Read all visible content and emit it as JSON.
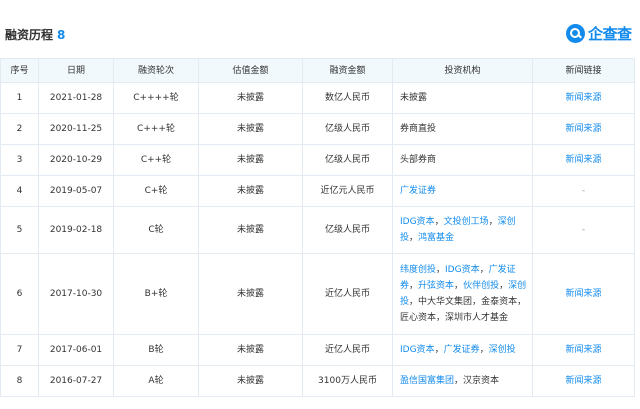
{
  "header": {
    "title": "融资历程",
    "count": "8"
  },
  "logo": {
    "text": "企查查",
    "accent": "#128bed"
  },
  "table": {
    "columns": [
      "序号",
      "日期",
      "融资轮次",
      "估值金额",
      "融资金额",
      "投资机构",
      "新闻链接"
    ],
    "rows": [
      {
        "no": "1",
        "date": "2021-01-28",
        "round": "C++++轮",
        "valuation": "未披露",
        "amount": "数亿人民币",
        "investors": [
          {
            "name": "未披露",
            "linked": false
          }
        ],
        "news": "新闻来源",
        "news_linked": true
      },
      {
        "no": "2",
        "date": "2020-11-25",
        "round": "C+++轮",
        "valuation": "未披露",
        "amount": "亿级人民币",
        "investors": [
          {
            "name": "券商直投",
            "linked": false
          }
        ],
        "news": "新闻来源",
        "news_linked": true
      },
      {
        "no": "3",
        "date": "2020-10-29",
        "round": "C++轮",
        "valuation": "未披露",
        "amount": "亿级人民币",
        "investors": [
          {
            "name": "头部券商",
            "linked": false
          }
        ],
        "news": "新闻来源",
        "news_linked": true
      },
      {
        "no": "4",
        "date": "2019-05-07",
        "round": "C+轮",
        "valuation": "未披露",
        "amount": "近亿元人民币",
        "investors": [
          {
            "name": "广发证券",
            "linked": true
          }
        ],
        "news": "-",
        "news_linked": false
      },
      {
        "no": "5",
        "date": "2019-02-18",
        "round": "C轮",
        "valuation": "未披露",
        "amount": "亿级人民币",
        "investors": [
          {
            "name": "IDG资本",
            "linked": true
          },
          {
            "name": "文投创工场",
            "linked": true
          },
          {
            "name": "深创投",
            "linked": true
          },
          {
            "name": "鸿富基金",
            "linked": true
          }
        ],
        "news": "-",
        "news_linked": false
      },
      {
        "no": "6",
        "date": "2017-10-30",
        "round": "B+轮",
        "valuation": "未披露",
        "amount": "近亿人民币",
        "investors": [
          {
            "name": "纬度创投",
            "linked": true
          },
          {
            "name": "IDG资本",
            "linked": true
          },
          {
            "name": "广发证券",
            "linked": true
          },
          {
            "name": "升弦资本",
            "linked": true
          },
          {
            "name": "伙伴创投",
            "linked": true
          },
          {
            "name": "深创投",
            "linked": true
          },
          {
            "name": "中大华文集团",
            "linked": false
          },
          {
            "name": "金泰资本",
            "linked": false
          },
          {
            "name": "匠心资本",
            "linked": false
          },
          {
            "name": "深圳市人才基金",
            "linked": false
          }
        ],
        "news": "新闻来源",
        "news_linked": true
      },
      {
        "no": "7",
        "date": "2017-06-01",
        "round": "B轮",
        "valuation": "未披露",
        "amount": "近亿人民币",
        "investors": [
          {
            "name": "IDG资本",
            "linked": true
          },
          {
            "name": "广发证券",
            "linked": true
          },
          {
            "name": "深创投",
            "linked": true
          }
        ],
        "news": "新闻来源",
        "news_linked": true
      },
      {
        "no": "8",
        "date": "2016-07-27",
        "round": "A轮",
        "valuation": "未披露",
        "amount": "3100万人民币",
        "investors": [
          {
            "name": "盈信国富集团",
            "linked": true
          },
          {
            "name": "汉京资本",
            "linked": false
          }
        ],
        "news": "新闻来源",
        "news_linked": true
      }
    ]
  }
}
